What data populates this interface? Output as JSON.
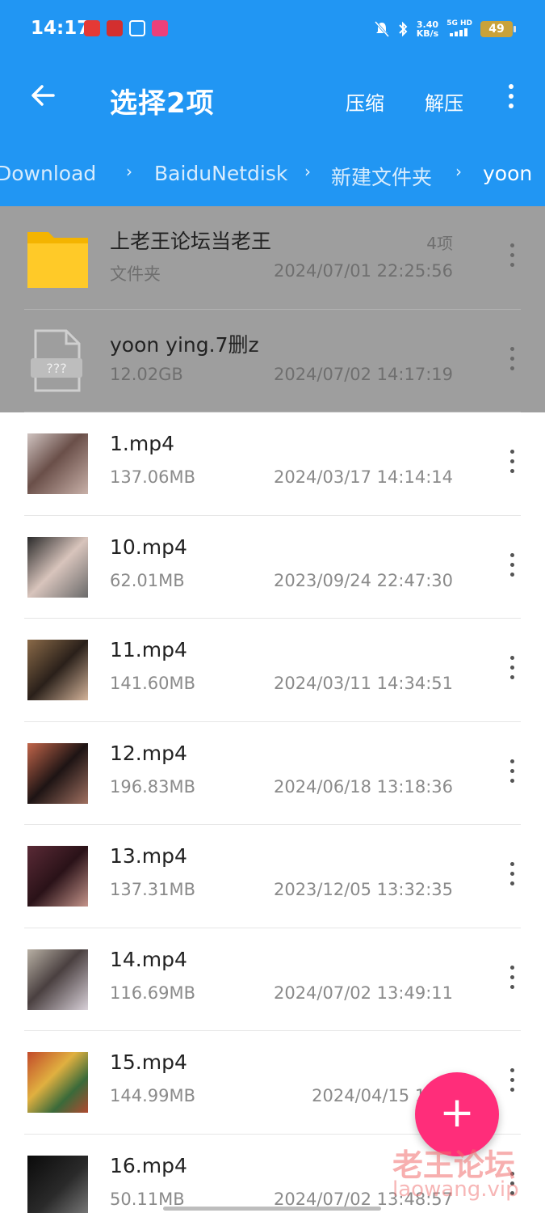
{
  "status_bar": {
    "time": "14:17",
    "speed_value": "3.40",
    "speed_unit": "KB/s",
    "network": "5G HD",
    "battery": "49"
  },
  "app_bar": {
    "title": "选择2项",
    "compress_label": "压缩",
    "extract_label": "解压"
  },
  "breadcrumb": [
    "Download",
    "BaiduNetdisk",
    "新建文件夹",
    "yoon"
  ],
  "items": [
    {
      "name": "上老王论坛当老王",
      "kind": "folder",
      "meta": "文件夹",
      "count": "4项",
      "date": "2024/07/01 22:25:56",
      "selected": true
    },
    {
      "name": "yoon ying.7删z",
      "kind": "unknown",
      "meta": "12.02GB",
      "date": "2024/07/02 14:17:19",
      "selected": true
    },
    {
      "name": "1.mp4",
      "kind": "video",
      "meta": "137.06MB",
      "date": "2024/03/17 14:14:14",
      "selected": false
    },
    {
      "name": "10.mp4",
      "kind": "video",
      "meta": "62.01MB",
      "date": "2023/09/24 22:47:30",
      "selected": false
    },
    {
      "name": "11.mp4",
      "kind": "video",
      "meta": "141.60MB",
      "date": "2024/03/11 14:34:51",
      "selected": false
    },
    {
      "name": "12.mp4",
      "kind": "video",
      "meta": "196.83MB",
      "date": "2024/06/18 13:18:36",
      "selected": false
    },
    {
      "name": "13.mp4",
      "kind": "video",
      "meta": "137.31MB",
      "date": "2023/12/05 13:32:35",
      "selected": false
    },
    {
      "name": "14.mp4",
      "kind": "video",
      "meta": "116.69MB",
      "date": "2024/07/02 13:49:11",
      "selected": false
    },
    {
      "name": "15.mp4",
      "kind": "video",
      "meta": "144.99MB",
      "date": "2024/04/15 13:3",
      "selected": false
    },
    {
      "name": "16.mp4",
      "kind": "video",
      "meta": "50.11MB",
      "date": "2024/07/02 13:48:57",
      "selected": false
    }
  ],
  "watermark": {
    "title": "老王论坛",
    "url": "laowang.vip"
  },
  "colors": {
    "accent": "#2196F3",
    "fab": "#ff2d7a",
    "selected_row": "#9e9e9e"
  }
}
